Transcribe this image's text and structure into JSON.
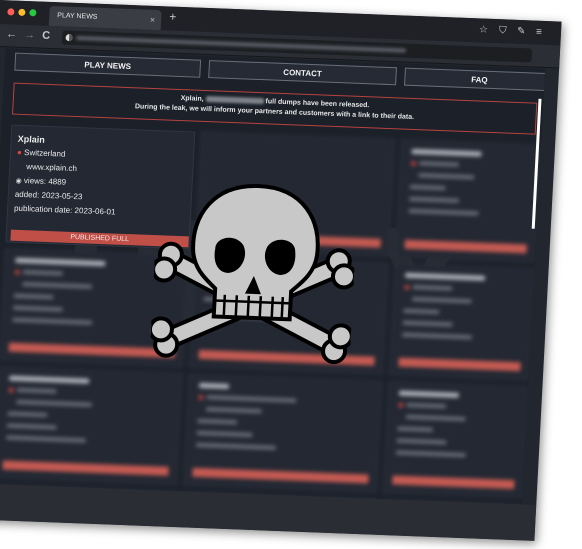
{
  "browser": {
    "tab_title": "PLAY NEWS",
    "tab_close": "×",
    "new_tab": "+",
    "traffic_lights": [
      "#ff5f57",
      "#febc2e",
      "#28c840"
    ]
  },
  "nav": {
    "back": "←",
    "forward": "→",
    "reload": "C",
    "bookmark_icon": "☆",
    "shield_icon": "⛉",
    "extension_icon": "✎",
    "menu_icon": "≡"
  },
  "menu": {
    "items": [
      "PLAY NEWS",
      "CONTACT",
      "FAQ"
    ]
  },
  "banner": {
    "line1_start": "Xplain,",
    "line1_end": "full dumps have been released.",
    "line2": "During the leak, we will inform your partners and customers with a link to their data."
  },
  "victim": {
    "name": "Xplain",
    "country": "Switzerland",
    "website": "www.xplain.ch",
    "views": "views: 4889",
    "added": "added: 2023-05-23",
    "publication": "publication date: 2023-06-01",
    "status": "PUBLISHED FULL"
  },
  "colors": {
    "accent": "#c04f48",
    "background": "#1b2029",
    "card": "#232833"
  }
}
